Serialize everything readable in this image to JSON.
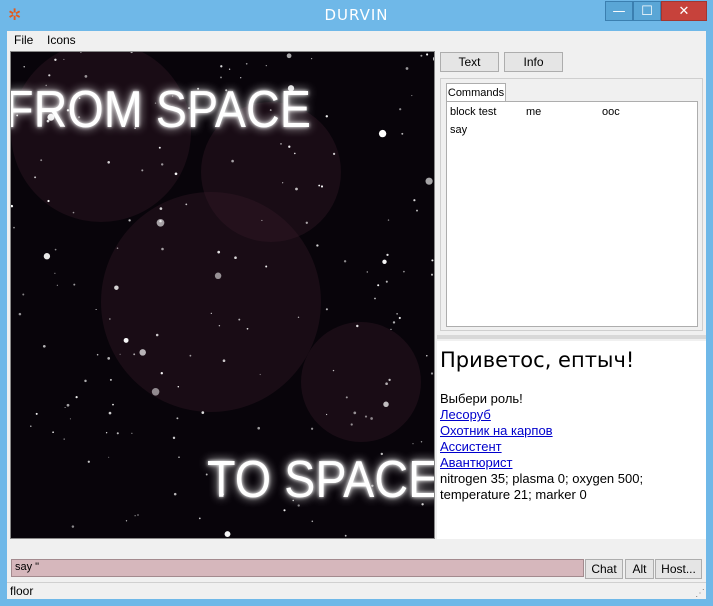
{
  "window": {
    "title": "DURVIN",
    "icon": "gear-flower-icon",
    "min_glyph": "—",
    "max_glyph": "☐",
    "close_glyph": "✕"
  },
  "menu": {
    "items": [
      "File",
      "Icons"
    ]
  },
  "map": {
    "line1": "FROM SPACE",
    "line2": "TO SPACE"
  },
  "right": {
    "tabs": [
      "Text",
      "Info"
    ],
    "commands_tab": "Commands",
    "commands": [
      "block test",
      "me",
      "ooc",
      "say"
    ]
  },
  "output": {
    "greeting": "Приветос, ептыч!",
    "prompt": "Выбери роль!",
    "roles": [
      "Лесоруб",
      "Охотник на карпов",
      "Ассистент",
      "Авантюрист"
    ],
    "gas_line1": "nitrogen 35; plasma 0; oxygen 500;",
    "gas_line2": "temperature 21; marker 0"
  },
  "input": {
    "value": "say \""
  },
  "buttons": {
    "chat": "Chat",
    "alt": "Alt",
    "host": "Host..."
  },
  "status": {
    "text": "floor"
  }
}
